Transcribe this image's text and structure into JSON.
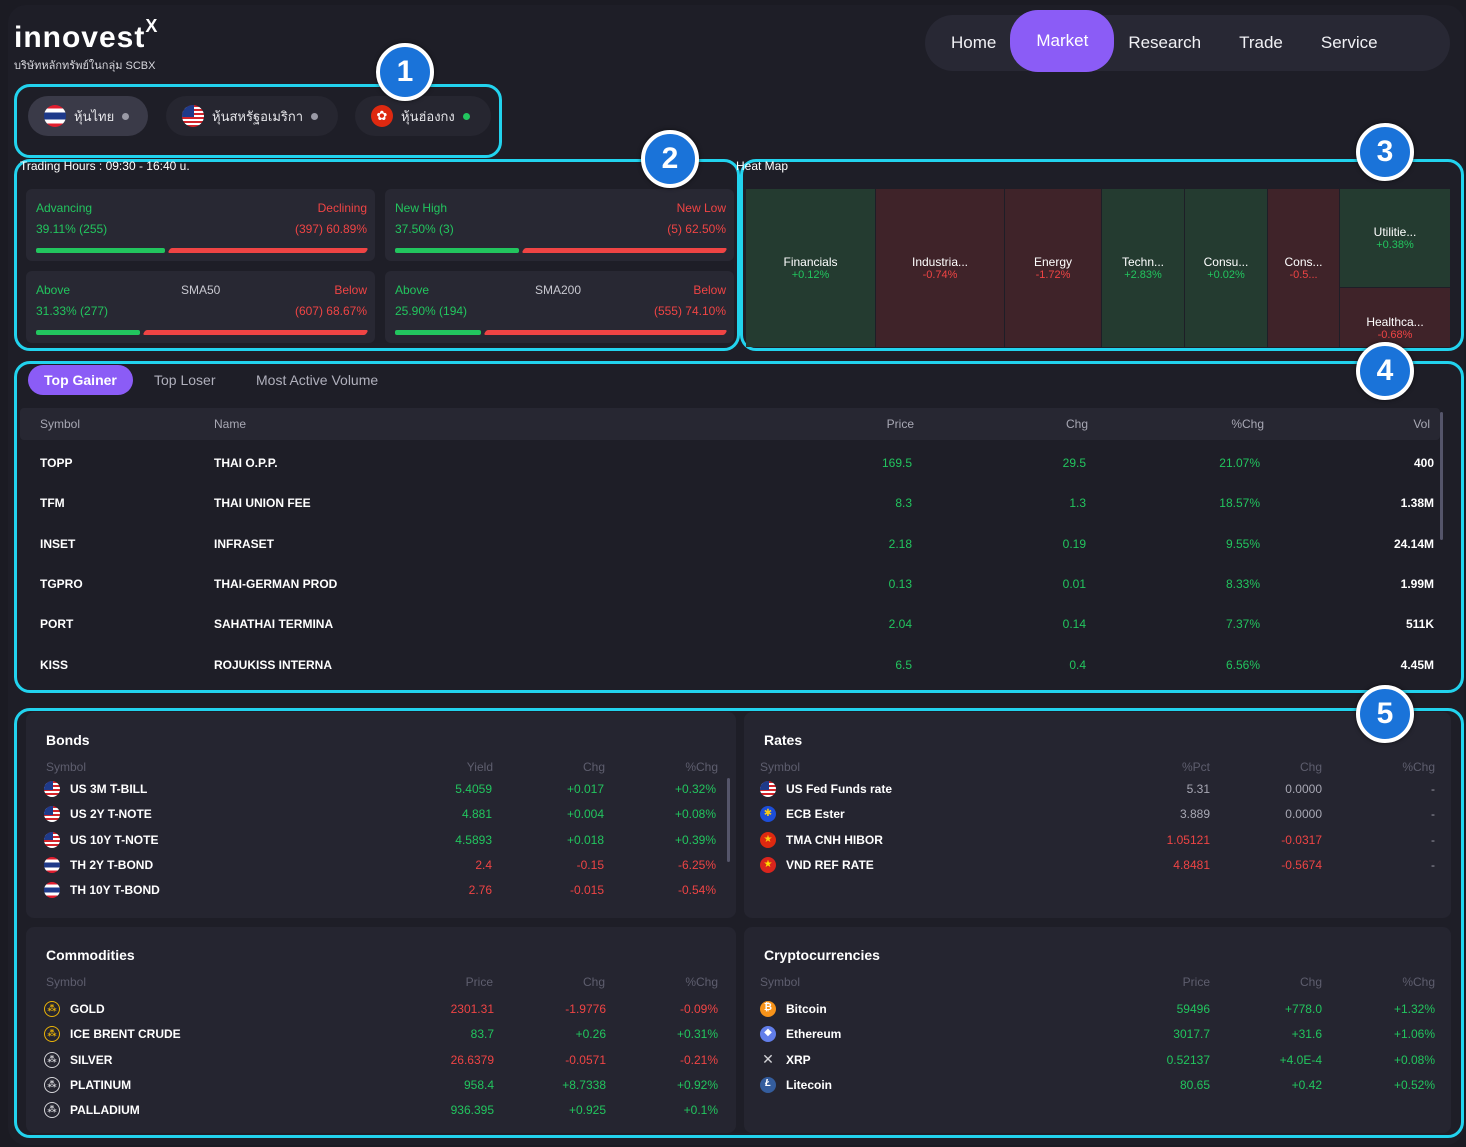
{
  "logo": {
    "brand": "innovest",
    "brand_sup": "X",
    "subtitle": "บริษัทหลักทรัพย์ในกลุ่ม SCBX"
  },
  "nav": {
    "items": [
      "Home",
      "Market",
      "Research",
      "Trade",
      "Service"
    ],
    "active": "Market"
  },
  "badges": [
    "1",
    "2",
    "3",
    "4",
    "5"
  ],
  "markets": [
    {
      "label": "หุ้นไทย",
      "flag": "TH",
      "status_color": "#9a9aa6",
      "selected": true
    },
    {
      "label": "หุ้นสหรัฐอเมริกา",
      "flag": "US",
      "status_color": "#9a9aa6",
      "selected": false
    },
    {
      "label": "หุ้นฮ่องกง",
      "flag": "HK",
      "status_color": "#22c55e",
      "selected": false
    }
  ],
  "breadth": {
    "trading_hours": "Trading Hours : 09:30 - 16:40 u.",
    "advancing": {
      "left_label": "Advancing",
      "right_label": "Declining",
      "left_value": "39.11% (255)",
      "right_value": "(397) 60.89%",
      "ratio": 0.3911
    },
    "new_high": {
      "left_label": "New High",
      "right_label": "New Low",
      "left_value": "37.50% (3)",
      "right_value": "(5) 62.50%",
      "ratio": 0.375
    },
    "sma50": {
      "left_label": "Above",
      "center_label": "SMA50",
      "right_label": "Below",
      "left_value": "31.33% (277)",
      "right_value": "(607) 68.67%",
      "ratio": 0.3133
    },
    "sma200": {
      "left_label": "Above",
      "center_label": "SMA200",
      "right_label": "Below",
      "left_value": "25.90% (194)",
      "right_value": "(555) 74.10%",
      "ratio": 0.259
    }
  },
  "heatmap": {
    "title": "Heat Map",
    "cells": [
      {
        "name": "Financials",
        "pct": "+0.12%"
      },
      {
        "name": "Industria...",
        "pct": "-0.74%"
      },
      {
        "name": "Energy",
        "pct": "-1.72%"
      },
      {
        "name": "Techn...",
        "pct": "+2.83%"
      },
      {
        "name": "Consu...",
        "pct": "+0.02%"
      },
      {
        "name": "Cons...",
        "pct": "-0.5..."
      },
      {
        "name": "Utilitie...",
        "pct": "+0.38%"
      },
      {
        "name": "Healthca...",
        "pct": "-0.68%"
      }
    ]
  },
  "top_tabs": [
    "Top Gainer",
    "Top Loser",
    "Most Active Volume"
  ],
  "top_table": {
    "headers": [
      "Symbol",
      "Name",
      "Price",
      "Chg",
      "%Chg",
      "Vol"
    ],
    "rows": [
      [
        "TOPP",
        "THAI O.P.P.",
        "169.5",
        "29.5",
        "21.07%",
        "400"
      ],
      [
        "TFM",
        "THAI UNION FEE",
        "8.3",
        "1.3",
        "18.57%",
        "1.38M"
      ],
      [
        "INSET",
        "INFRASET",
        "2.18",
        "0.19",
        "9.55%",
        "24.14M"
      ],
      [
        "TGPRO",
        "THAI-GERMAN PROD",
        "0.13",
        "0.01",
        "8.33%",
        "1.99M"
      ],
      [
        "PORT",
        "SAHATHAI TERMINA",
        "2.04",
        "0.14",
        "7.37%",
        "511K"
      ],
      [
        "KISS",
        "ROJUKISS INTERNA",
        "6.5",
        "0.4",
        "6.56%",
        "4.45M"
      ]
    ]
  },
  "bonds": {
    "title": "Bonds",
    "headers": [
      "Symbol",
      "Yield",
      "Chg",
      "%Chg"
    ],
    "rows": [
      [
        "US 3M T-BILL",
        "5.4059",
        "+0.017",
        "+0.32%"
      ],
      [
        "US 2Y T-NOTE",
        "4.881",
        "+0.004",
        "+0.08%"
      ],
      [
        "US 10Y T-NOTE",
        "4.5893",
        "+0.018",
        "+0.39%"
      ],
      [
        "TH 2Y T-BOND",
        "2.4",
        "-0.15",
        "-6.25%"
      ],
      [
        "TH 10Y T-BOND",
        "2.76",
        "-0.015",
        "-0.54%"
      ]
    ]
  },
  "rates": {
    "title": "Rates",
    "headers": [
      "Symbol",
      "%Pct",
      "Chg",
      "%Chg"
    ],
    "rows": [
      [
        "US Fed Funds rate",
        "5.31",
        "0.0000",
        "-"
      ],
      [
        "ECB Ester",
        "3.889",
        "0.0000",
        "-"
      ],
      [
        "TMA CNH HIBOR",
        "1.05121",
        "-0.0317",
        "-"
      ],
      [
        "VND REF RATE",
        "4.8481",
        "-0.5674",
        "-"
      ]
    ]
  },
  "commodities": {
    "title": "Commodities",
    "headers": [
      "Symbol",
      "Price",
      "Chg",
      "%Chg"
    ],
    "rows": [
      [
        "GOLD",
        "2301.31",
        "-1.9776",
        "-0.09%"
      ],
      [
        "ICE BRENT CRUDE",
        "83.7",
        "+0.26",
        "+0.31%"
      ],
      [
        "SILVER",
        "26.6379",
        "-0.0571",
        "-0.21%"
      ],
      [
        "PLATINUM",
        "958.4",
        "+8.7338",
        "+0.92%"
      ],
      [
        "PALLADIUM",
        "936.395",
        "+0.925",
        "+0.1%"
      ]
    ]
  },
  "crypto": {
    "title": "Cryptocurrencies",
    "headers": [
      "Symbol",
      "Price",
      "Chg",
      "%Chg"
    ],
    "rows": [
      [
        "Bitcoin",
        "59496",
        "+778.0",
        "+1.32%"
      ],
      [
        "Ethereum",
        "3017.7",
        "+31.6",
        "+1.06%"
      ],
      [
        "XRP",
        "0.52137",
        "+4.0E-4",
        "+0.08%"
      ],
      [
        "Litecoin",
        "80.65",
        "+0.42",
        "+0.52%"
      ]
    ]
  },
  "colors": {
    "accent": "#8b5cf6",
    "positive": "#22c55e",
    "negative": "#ef4444",
    "callout": "#22d3ee"
  }
}
